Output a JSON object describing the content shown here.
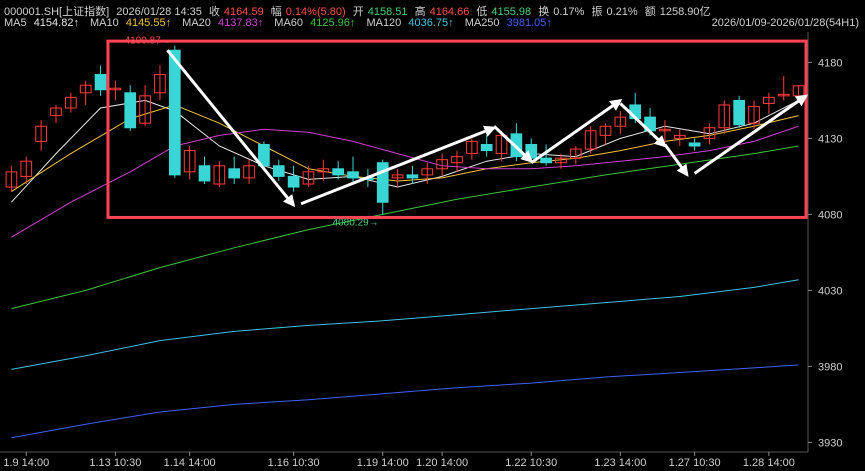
{
  "header": {
    "code": "000001.SH[上证指数]",
    "time": "2026/01/28 14:35",
    "close_label": "收",
    "close": "4164.59",
    "change_label": "幅",
    "change": "0.14%(5.80)",
    "open_label": "开",
    "open": "4158.51",
    "high_label": "高",
    "high": "4164.66",
    "low_label": "低",
    "low": "4155.98",
    "turnover_label": "换",
    "turnover": "0.17%",
    "amplitude_label": "振",
    "amplitude": "0.21%",
    "amount_label": "额",
    "amount": "1258.90亿",
    "ma": [
      {
        "label": "MA5",
        "value": "4154.82↑",
        "color": "#e8e8e8"
      },
      {
        "label": "MA10",
        "value": "4145.55↑",
        "color": "#f0c040"
      },
      {
        "label": "MA20",
        "value": "4137.83↑",
        "color": "#d040d0"
      },
      {
        "label": "MA60",
        "value": "4125.96↑",
        "color": "#40c040"
      },
      {
        "label": "MA120",
        "value": "4036.75↑",
        "color": "#40c0e0"
      },
      {
        "label": "MA250",
        "value": "3981.05↑",
        "color": "#4060f0"
      }
    ],
    "range": "2026/01/09-2026/01/28(54H1)"
  },
  "chart_data": {
    "type": "candlestick",
    "y_ticks": [
      4180,
      4130,
      4080,
      4030,
      3980,
      3930
    ],
    "ylim": [
      3925,
      4200
    ],
    "x_tick_labels": [
      "1.9 14:00",
      "1.13 10:30",
      "1.14 14:00",
      "1.16 10:30",
      "1.19 14:00",
      "1.20 14:00",
      "1.22 10:30",
      "1.23 14:00",
      "1.27 10:30",
      "1.28 14:00"
    ],
    "x_tick_index": [
      1,
      7,
      12,
      19,
      25,
      29,
      35,
      41,
      46,
      51
    ],
    "high_annotation": "4190.87→",
    "low_annotation": "4080.29→",
    "candles": [
      {
        "o": 4098,
        "h": 4112,
        "l": 4095,
        "c": 4108
      },
      {
        "o": 4105,
        "h": 4118,
        "l": 4100,
        "c": 4115
      },
      {
        "o": 4128,
        "h": 4142,
        "l": 4122,
        "c": 4138
      },
      {
        "o": 4145,
        "h": 4152,
        "l": 4140,
        "c": 4150
      },
      {
        "o": 4150,
        "h": 4160,
        "l": 4147,
        "c": 4157
      },
      {
        "o": 4160,
        "h": 4168,
        "l": 4152,
        "c": 4165
      },
      {
        "o": 4172,
        "h": 4178,
        "l": 4158,
        "c": 4162
      },
      {
        "o": 4162,
        "h": 4168,
        "l": 4155,
        "c": 4163
      },
      {
        "o": 4160,
        "h": 4165,
        "l": 4135,
        "c": 4137
      },
      {
        "o": 4140,
        "h": 4165,
        "l": 4138,
        "c": 4158
      },
      {
        "o": 4160,
        "h": 4178,
        "l": 4155,
        "c": 4172
      },
      {
        "o": 4188,
        "h": 4191,
        "l": 4104,
        "c": 4106
      },
      {
        "o": 4108,
        "h": 4125,
        "l": 4103,
        "c": 4122
      },
      {
        "o": 4112,
        "h": 4118,
        "l": 4100,
        "c": 4102
      },
      {
        "o": 4100,
        "h": 4115,
        "l": 4098,
        "c": 4112
      },
      {
        "o": 4110,
        "h": 4118,
        "l": 4100,
        "c": 4104
      },
      {
        "o": 4104,
        "h": 4116,
        "l": 4100,
        "c": 4112
      },
      {
        "o": 4126,
        "h": 4128,
        "l": 4110,
        "c": 4112
      },
      {
        "o": 4112,
        "h": 4116,
        "l": 4102,
        "c": 4105
      },
      {
        "o": 4105,
        "h": 4112,
        "l": 4095,
        "c": 4098
      },
      {
        "o": 4100,
        "h": 4112,
        "l": 4098,
        "c": 4108
      },
      {
        "o": 4108,
        "h": 4116,
        "l": 4102,
        "c": 4110
      },
      {
        "o": 4110,
        "h": 4115,
        "l": 4103,
        "c": 4106
      },
      {
        "o": 4108,
        "h": 4118,
        "l": 4100,
        "c": 4104
      },
      {
        "o": 4104,
        "h": 4110,
        "l": 4098,
        "c": 4103
      },
      {
        "o": 4114,
        "h": 4116,
        "l": 4080,
        "c": 4088
      },
      {
        "o": 4104,
        "h": 4110,
        "l": 4098,
        "c": 4106
      },
      {
        "o": 4106,
        "h": 4112,
        "l": 4100,
        "c": 4104
      },
      {
        "o": 4106,
        "h": 4114,
        "l": 4100,
        "c": 4110
      },
      {
        "o": 4110,
        "h": 4120,
        "l": 4105,
        "c": 4116
      },
      {
        "o": 4114,
        "h": 4122,
        "l": 4108,
        "c": 4118
      },
      {
        "o": 4120,
        "h": 4130,
        "l": 4116,
        "c": 4128
      },
      {
        "o": 4126,
        "h": 4132,
        "l": 4118,
        "c": 4122
      },
      {
        "o": 4120,
        "h": 4135,
        "l": 4115,
        "c": 4132
      },
      {
        "o": 4133,
        "h": 4140,
        "l": 4115,
        "c": 4118
      },
      {
        "o": 4126,
        "h": 4130,
        "l": 4114,
        "c": 4117
      },
      {
        "o": 4117,
        "h": 4126,
        "l": 4112,
        "c": 4114
      },
      {
        "o": 4114,
        "h": 4120,
        "l": 4110,
        "c": 4117
      },
      {
        "o": 4117,
        "h": 4125,
        "l": 4113,
        "c": 4123
      },
      {
        "o": 4123,
        "h": 4138,
        "l": 4120,
        "c": 4135
      },
      {
        "o": 4132,
        "h": 4140,
        "l": 4126,
        "c": 4138
      },
      {
        "o": 4138,
        "h": 4148,
        "l": 4133,
        "c": 4144
      },
      {
        "o": 4152,
        "h": 4160,
        "l": 4140,
        "c": 4143
      },
      {
        "o": 4144,
        "h": 4150,
        "l": 4132,
        "c": 4135
      },
      {
        "o": 4135,
        "h": 4142,
        "l": 4127,
        "c": 4136
      },
      {
        "o": 4130,
        "h": 4136,
        "l": 4125,
        "c": 4132
      },
      {
        "o": 4127,
        "h": 4130,
        "l": 4122,
        "c": 4125
      },
      {
        "o": 4130,
        "h": 4140,
        "l": 4126,
        "c": 4137
      },
      {
        "o": 4137,
        "h": 4155,
        "l": 4133,
        "c": 4152
      },
      {
        "o": 4155,
        "h": 4158,
        "l": 4137,
        "c": 4139
      },
      {
        "o": 4140,
        "h": 4155,
        "l": 4136,
        "c": 4151
      },
      {
        "o": 4153,
        "h": 4160,
        "l": 4146,
        "c": 4157
      },
      {
        "o": 4158,
        "h": 4171,
        "l": 4155,
        "c": 4159
      },
      {
        "o": 4158,
        "h": 4165,
        "l": 4155,
        "c": 4164.59
      }
    ],
    "ma_lines": [
      {
        "label": "MA5",
        "color": "#e8e8e8",
        "points": [
          [
            0,
            4088
          ],
          [
            3,
            4120
          ],
          [
            6,
            4150
          ],
          [
            9,
            4155
          ],
          [
            11,
            4148
          ],
          [
            14,
            4125
          ],
          [
            17,
            4112
          ],
          [
            20,
            4103
          ],
          [
            23,
            4105
          ],
          [
            26,
            4098
          ],
          [
            29,
            4105
          ],
          [
            32,
            4115
          ],
          [
            35,
            4120
          ],
          [
            38,
            4118
          ],
          [
            41,
            4130
          ],
          [
            44,
            4138
          ],
          [
            47,
            4133
          ],
          [
            50,
            4140
          ],
          [
            53,
            4155
          ]
        ]
      },
      {
        "label": "MA10",
        "color": "#f0c040",
        "points": [
          [
            0,
            4095
          ],
          [
            4,
            4120
          ],
          [
            8,
            4143
          ],
          [
            11,
            4152
          ],
          [
            14,
            4140
          ],
          [
            17,
            4125
          ],
          [
            20,
            4110
          ],
          [
            23,
            4105
          ],
          [
            26,
            4102
          ],
          [
            29,
            4104
          ],
          [
            32,
            4110
          ],
          [
            35,
            4114
          ],
          [
            38,
            4117
          ],
          [
            41,
            4122
          ],
          [
            44,
            4128
          ],
          [
            47,
            4132
          ],
          [
            50,
            4138
          ],
          [
            53,
            4145
          ]
        ]
      },
      {
        "label": "MA20",
        "color": "#d040d0",
        "points": [
          [
            0,
            4065
          ],
          [
            4,
            4088
          ],
          [
            8,
            4108
          ],
          [
            11,
            4125
          ],
          [
            14,
            4132
          ],
          [
            17,
            4136
          ],
          [
            20,
            4134
          ],
          [
            23,
            4128
          ],
          [
            26,
            4120
          ],
          [
            29,
            4112
          ],
          [
            32,
            4110
          ],
          [
            35,
            4110
          ],
          [
            38,
            4112
          ],
          [
            41,
            4115
          ],
          [
            44,
            4118
          ],
          [
            47,
            4122
          ],
          [
            50,
            4128
          ],
          [
            53,
            4138
          ]
        ]
      },
      {
        "label": "MA60",
        "color": "#40c040",
        "points": [
          [
            0,
            4018
          ],
          [
            5,
            4030
          ],
          [
            10,
            4045
          ],
          [
            15,
            4058
          ],
          [
            20,
            4070
          ],
          [
            25,
            4080
          ],
          [
            30,
            4090
          ],
          [
            35,
            4098
          ],
          [
            40,
            4106
          ],
          [
            45,
            4113
          ],
          [
            50,
            4120
          ],
          [
            53,
            4125
          ]
        ]
      },
      {
        "label": "MA120",
        "color": "#40c0e0",
        "points": [
          [
            0,
            3978
          ],
          [
            5,
            3987
          ],
          [
            10,
            3997
          ],
          [
            15,
            4003
          ],
          [
            20,
            4007
          ],
          [
            25,
            4010
          ],
          [
            30,
            4014
          ],
          [
            35,
            4018
          ],
          [
            40,
            4022
          ],
          [
            45,
            4026
          ],
          [
            50,
            4032
          ],
          [
            53,
            4037
          ]
        ]
      },
      {
        "label": "MA250",
        "color": "#4060f0",
        "points": [
          [
            0,
            3933
          ],
          [
            5,
            3942
          ],
          [
            10,
            3950
          ],
          [
            15,
            3955
          ],
          [
            20,
            3958
          ],
          [
            25,
            3962
          ],
          [
            30,
            3966
          ],
          [
            35,
            3969
          ],
          [
            40,
            3973
          ],
          [
            45,
            3976
          ],
          [
            50,
            3979
          ],
          [
            53,
            3981
          ]
        ]
      }
    ],
    "annotation_box": {
      "x0": 6.5,
      "x1": 53.5,
      "y0": 4078,
      "y1": 4194,
      "color": "#ff4455"
    },
    "arrows": [
      {
        "from": [
          10.5,
          4188
        ],
        "to": [
          19,
          4086
        ]
      },
      {
        "from": [
          19.5,
          4087
        ],
        "to": [
          32.5,
          4137
        ]
      },
      {
        "from": [
          32.5,
          4138
        ],
        "to": [
          35,
          4115
        ]
      },
      {
        "from": [
          35,
          4114
        ],
        "to": [
          41,
          4155
        ]
      },
      {
        "from": [
          41,
          4153
        ],
        "to": [
          44,
          4125
        ]
      },
      {
        "from": [
          44,
          4126
        ],
        "to": [
          45.5,
          4106
        ]
      },
      {
        "from": [
          46,
          4107
        ],
        "to": [
          53.5,
          4158
        ]
      }
    ]
  }
}
